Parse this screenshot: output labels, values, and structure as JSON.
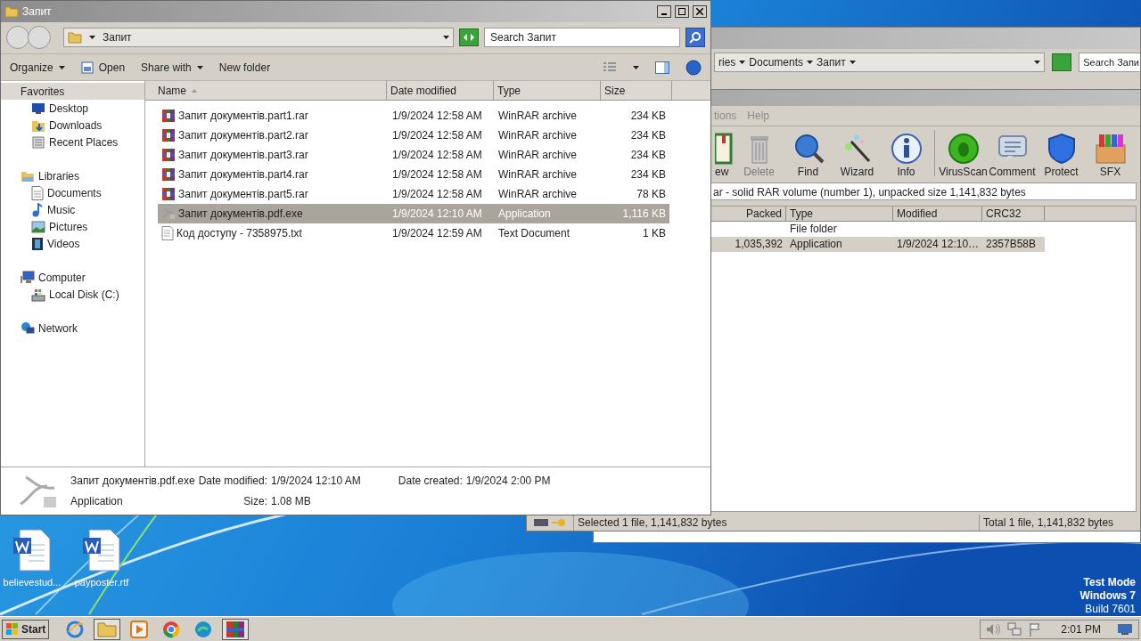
{
  "back_explorer": {
    "breadcrumb": [
      "ries",
      "Documents",
      "Запит"
    ],
    "search_placeholder": "Search Запи"
  },
  "winrar": {
    "menu": [
      "tions",
      "Help"
    ],
    "tools": [
      {
        "label": "ew",
        "disabled": false
      },
      {
        "label": "Delete",
        "disabled": true
      },
      {
        "label": "Find",
        "disabled": false
      },
      {
        "label": "Wizard",
        "disabled": false
      },
      {
        "label": "Info",
        "disabled": false
      },
      {
        "label": "VirusScan",
        "disabled": false
      },
      {
        "label": "Comment",
        "disabled": false
      },
      {
        "label": "Protect",
        "disabled": false
      },
      {
        "label": "SFX",
        "disabled": false
      }
    ],
    "info": "ar - solid RAR volume (number 1), unpacked size 1,141,832 bytes",
    "columns": [
      "Packed",
      "Type",
      "Modified",
      "CRC32"
    ],
    "rows": [
      {
        "type": "File folder",
        "selected": false
      },
      {
        "packed": "1,035,392",
        "type": "Application",
        "modified": "1/9/2024 12:10…",
        "crc": "2357B58B",
        "selected": true
      }
    ],
    "status": [
      "Selected 1 file, 1,141,832 bytes",
      "Total 1 file, 1,141,832 bytes"
    ]
  },
  "explorer": {
    "title": "Запит",
    "breadcrumb": [
      "Запит"
    ],
    "search_placeholder": "Search Запит",
    "commands": [
      {
        "label": "Organize",
        "kind": "dropdown"
      },
      {
        "label": "Open",
        "kind": "icon"
      },
      {
        "label": "Share with",
        "kind": "dropdown"
      },
      {
        "label": "New folder",
        "kind": "plain"
      }
    ],
    "sidebar": [
      {
        "label": "Favorites",
        "selected": true,
        "children": [
          {
            "label": "Desktop",
            "selected": false
          },
          {
            "label": "Downloads",
            "selected": false
          },
          {
            "label": "Recent Places",
            "selected": false
          }
        ]
      },
      {
        "label": "Libraries",
        "selected": false,
        "children": [
          {
            "label": "Documents",
            "selected": false
          },
          {
            "label": "Music",
            "selected": false
          },
          {
            "label": "Pictures",
            "selected": false
          },
          {
            "label": "Videos",
            "selected": false
          }
        ]
      },
      {
        "label": "Computer",
        "selected": false,
        "children": [
          {
            "label": "Local Disk (C:)",
            "selected": false
          }
        ]
      },
      {
        "label": "Network",
        "selected": false
      }
    ],
    "columns": [
      {
        "label": "Name",
        "sorted": true
      },
      {
        "label": "Date modified",
        "sorted": false
      },
      {
        "label": "Type",
        "sorted": false
      },
      {
        "label": "Size",
        "sorted": false
      }
    ],
    "files": [
      {
        "name": "Запит документів.part1.rar",
        "date": "1/9/2024 12:58 AM",
        "type": "WinRAR archive",
        "size": "234 KB",
        "kind": "rar",
        "selected": false
      },
      {
        "name": "Запит документів.part2.rar",
        "date": "1/9/2024 12:58 AM",
        "type": "WinRAR archive",
        "size": "234 KB",
        "kind": "rar",
        "selected": false
      },
      {
        "name": "Запит документів.part3.rar",
        "date": "1/9/2024 12:58 AM",
        "type": "WinRAR archive",
        "size": "234 KB",
        "kind": "rar",
        "selected": false
      },
      {
        "name": "Запит документів.part4.rar",
        "date": "1/9/2024 12:58 AM",
        "type": "WinRAR archive",
        "size": "234 KB",
        "kind": "rar",
        "selected": false
      },
      {
        "name": "Запит документів.part5.rar",
        "date": "1/9/2024 12:58 AM",
        "type": "WinRAR archive",
        "size": "78 KB",
        "kind": "rar",
        "selected": false
      },
      {
        "name": "Запит документів.pdf.exe",
        "date": "1/9/2024 12:10 AM",
        "type": "Application",
        "size": "1,116 KB",
        "kind": "exe",
        "selected": true
      },
      {
        "name": "Код доступу - 7358975.txt",
        "date": "1/9/2024 12:59 AM",
        "type": "Text Document",
        "size": "1 KB",
        "kind": "txt",
        "selected": false
      }
    ],
    "details": {
      "name": "Запит документів.pdf.exe",
      "type": "Application",
      "modified_label": "Date modified:",
      "modified": "1/9/2024 12:10 AM",
      "created_label": "Date created:",
      "created": "1/9/2024 2:00 PM",
      "size_label": "Size:",
      "size": "1.08 MB"
    }
  },
  "desktop_icons": [
    {
      "label": "believestud..."
    },
    {
      "label": "payposter.rtf"
    }
  ],
  "os_notice": [
    "Test Mode",
    "Windows 7",
    "Build 7601"
  ],
  "taskbar": {
    "start": "Start",
    "apps": [
      {
        "kind": "ie",
        "active": false
      },
      {
        "kind": "folder",
        "active": true
      },
      {
        "kind": "media",
        "active": false
      },
      {
        "kind": "chrome",
        "active": false
      },
      {
        "kind": "edge",
        "active": false
      },
      {
        "kind": "winrar",
        "active": true
      }
    ],
    "clock": "2:01 PM"
  }
}
